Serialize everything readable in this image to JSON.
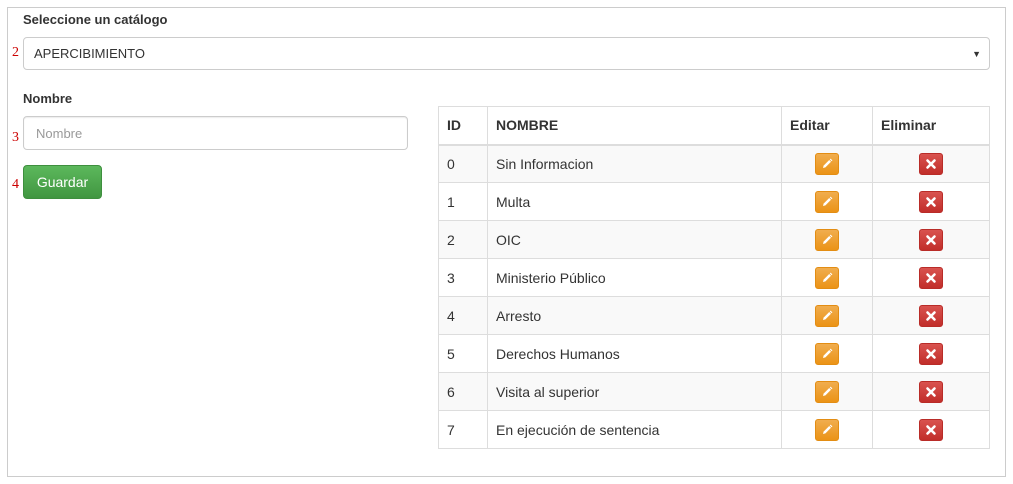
{
  "catalog": {
    "label": "Seleccione un catálogo",
    "selected": "APERCIBIMIENTO",
    "marker": "2"
  },
  "name_field": {
    "label": "Nombre",
    "placeholder": "Nombre",
    "value": "",
    "marker": "3"
  },
  "save_button": {
    "label": "Guardar",
    "marker": "4"
  },
  "table": {
    "headers": {
      "id": "ID",
      "name": "NOMBRE",
      "edit": "Editar",
      "delete": "Eliminar"
    },
    "rows": [
      {
        "id": "0",
        "name": "Sin Informacion"
      },
      {
        "id": "1",
        "name": "Multa"
      },
      {
        "id": "2",
        "name": "OIC"
      },
      {
        "id": "3",
        "name": "Ministerio Público"
      },
      {
        "id": "4",
        "name": "Arresto"
      },
      {
        "id": "5",
        "name": "Derechos Humanos"
      },
      {
        "id": "6",
        "name": "Visita al superior"
      },
      {
        "id": "7",
        "name": "En ejecución de sentencia"
      }
    ]
  },
  "icons": {
    "edit": "pencil-icon",
    "delete": "remove-icon"
  },
  "colors": {
    "save": "#5cb85c",
    "edit": "#f0ad4e",
    "delete": "#d9534f",
    "marker": "#cc0000"
  }
}
